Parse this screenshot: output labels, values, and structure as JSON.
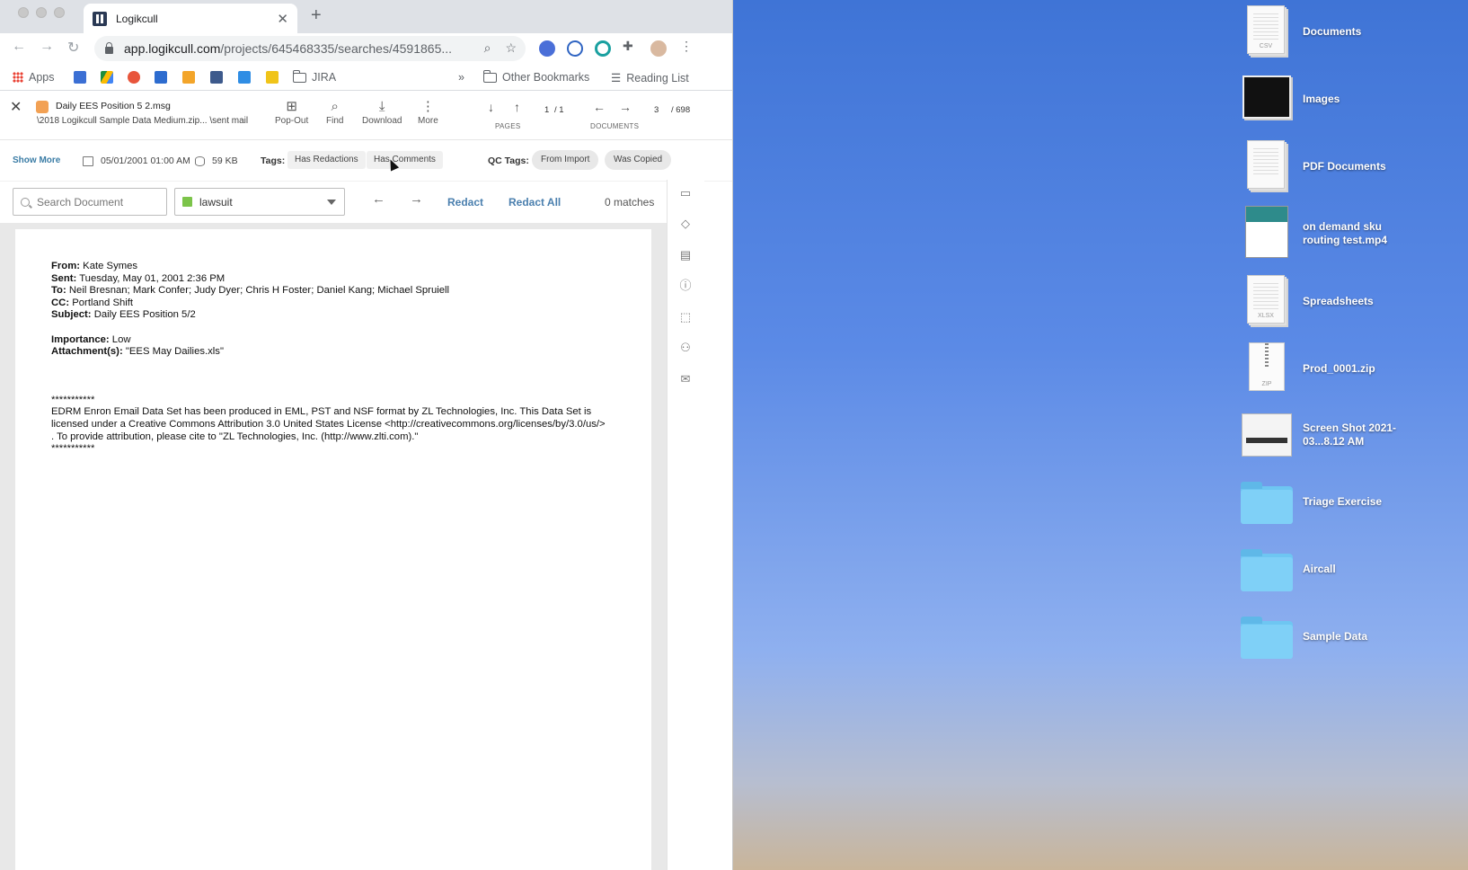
{
  "browser": {
    "tab_title": "Logikcull",
    "url_host": "app.logikcull.com",
    "url_path": "/projects/645468335/searches/4591865...",
    "bookmarks": {
      "apps": "Apps",
      "jira": "JIRA",
      "overflow": "»",
      "other": "Other Bookmarks",
      "reading_list": "Reading List"
    }
  },
  "header": {
    "doc_name": "Daily EES Position 5 2.msg",
    "doc_path": "\\2018 Logikcull Sample Data Medium.zip... \\sent mail",
    "tools": {
      "popout": "Pop-Out",
      "find": "Find",
      "download": "Download",
      "more": "More"
    },
    "pages": {
      "current": "1",
      "total": "/ 1",
      "caption": "PAGES"
    },
    "documents": {
      "current": "3",
      "total": "/ 698",
      "caption": "DOCUMENTS"
    }
  },
  "meta": {
    "show_more": "Show More",
    "date": "05/01/2001 01:00 AM",
    "size": "59 KB",
    "tags_label": "Tags:",
    "tags": [
      "Has Redactions",
      "Has Comments"
    ],
    "qc_label": "QC Tags:",
    "qc_tags": [
      "From Import",
      "Was Copied"
    ]
  },
  "search": {
    "placeholder": "Search Document",
    "redaction_reason": "lawsuit",
    "redaction_color": "#7cc44a",
    "redact": "Redact",
    "redact_all": "Redact All",
    "matches": "0 matches"
  },
  "email": {
    "from_label": "From:",
    "from": "Kate Symes",
    "sent_label": "Sent:",
    "sent": "Tuesday, May 01, 2001 2:36 PM",
    "to_label": "To:",
    "to": "Neil Bresnan; Mark Confer; Judy Dyer; Chris H Foster; Daniel Kang; Michael Spruiell",
    "cc_label": "CC:",
    "cc": "Portland Shift",
    "subject_label": "Subject:",
    "subject": "Daily EES Position 5/2",
    "importance_label": "Importance:",
    "importance": "Low",
    "attachments_label": "Attachment(s):",
    "attachments": "\"EES May Dailies.xls\"",
    "stars": "***********",
    "footer_1": "EDRM Enron Email Data Set has been produced in EML, PST and NSF format by ZL Technologies, Inc. This Data Set is",
    "footer_2": "licensed under a Creative Commons Attribution 3.0 United States License <http://creativecommons.org/licenses/by/3.0/us/>",
    "footer_3": ". To provide attribution, please cite to \"ZL Technologies, Inc. (http://www.zlti.com).\""
  },
  "desktop": {
    "items": [
      {
        "label": "Documents",
        "icon": "csv-stack-icon",
        "badge": "CSV"
      },
      {
        "label": "Images",
        "icon": "image-stack-icon"
      },
      {
        "label": "PDF Documents",
        "icon": "pdf-stack-icon"
      },
      {
        "label": "on demand sku routing test.mp4",
        "icon": "video-file-icon"
      },
      {
        "label": "Spreadsheets",
        "icon": "xlsx-stack-icon",
        "badge": "XLSX"
      },
      {
        "label": "Prod_0001.zip",
        "icon": "zip-file-icon",
        "badge": "ZIP"
      },
      {
        "label": "Screen Shot 2021-03...8.12 AM",
        "icon": "screenshot-file-icon"
      },
      {
        "label": "Triage Exercise",
        "icon": "folder-icon"
      },
      {
        "label": "Aircall",
        "icon": "folder-icon"
      },
      {
        "label": "Sample Data",
        "icon": "folder-icon"
      }
    ]
  }
}
